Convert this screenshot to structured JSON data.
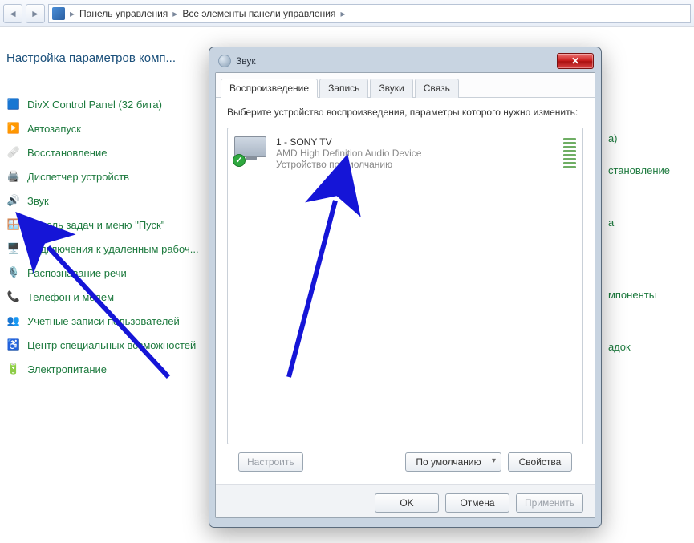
{
  "breadcrumb": {
    "item1": "Панель управления",
    "item2": "Все элементы панели управления"
  },
  "page": {
    "title": "Настройка параметров комп..."
  },
  "cp_items": [
    {
      "label": "DivX Control Panel (32 бита)",
      "icon": "🟦"
    },
    {
      "label": "Автозапуск",
      "icon": "▶️"
    },
    {
      "label": "Восстановление",
      "icon": "🩹"
    },
    {
      "label": "Диспетчер устройств",
      "icon": "🖨️"
    },
    {
      "label": "Звук",
      "icon": "🔊"
    },
    {
      "label": "Панель задач и меню \"Пуск\"",
      "icon": "🪟"
    },
    {
      "label": "Подключения к удаленным рабоч...",
      "icon": "🖥️"
    },
    {
      "label": "Распознавание речи",
      "icon": "🎙️"
    },
    {
      "label": "Телефон и модем",
      "icon": "📞"
    },
    {
      "label": "Учетные записи пользователей",
      "icon": "👥"
    },
    {
      "label": "Центр специальных возможностей",
      "icon": "♿"
    },
    {
      "label": "Электропитание",
      "icon": "🔋"
    }
  ],
  "right_hints": {
    "h0": "а)",
    "h1": "становление",
    "h2": "а",
    "h3": "мпоненты",
    "h4": "адок"
  },
  "dialog": {
    "title": "Звук",
    "tabs": {
      "playback": "Воспроизведение",
      "recording": "Запись",
      "sounds": "Звуки",
      "comm": "Связь"
    },
    "hint": "Выберите устройство воспроизведения, параметры которого нужно изменить:",
    "device": {
      "name": "1 - SONY TV",
      "driver": "AMD High Definition Audio Device",
      "status": "Устройство по умолчанию"
    },
    "buttons": {
      "configure": "Настроить",
      "setdefault": "По умолчанию",
      "properties": "Свойства",
      "ok": "OK",
      "cancel": "Отмена",
      "apply": "Применить"
    }
  }
}
